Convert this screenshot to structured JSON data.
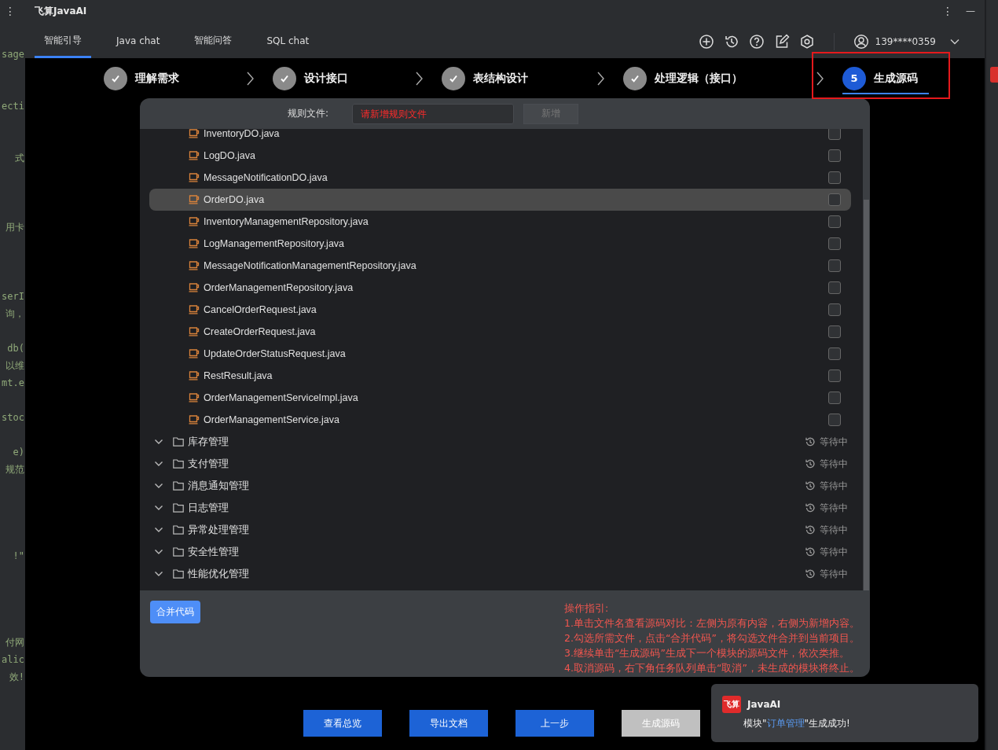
{
  "editor_fragments": [
    "sage",
    "ecti",
    "式",
    "用卡",
    "serI",
    "询，",
    "db(",
    "以维",
    "mt.e",
    "stoc",
    "e)",
    "规范",
    "!\"",
    "付网",
    "alic",
    "效!"
  ],
  "window": {
    "title": "飞算JavaAI",
    "menu_glyph": "⋮",
    "more_glyph": "⋮",
    "minimize_glyph": "—"
  },
  "tabs": [
    {
      "label": "智能引导",
      "selected": true
    },
    {
      "label": "Java chat",
      "selected": false
    },
    {
      "label": "智能问答",
      "selected": false
    },
    {
      "label": "SQL chat",
      "selected": false
    }
  ],
  "user": {
    "phone": "139****0359"
  },
  "steps": [
    {
      "label": "理解需求",
      "done": true,
      "highlighted": false
    },
    {
      "label": "设计接口",
      "done": true,
      "highlighted": false
    },
    {
      "label": "表结构设计",
      "done": true,
      "highlighted": false
    },
    {
      "label": "处理逻辑（接口）",
      "done": true,
      "highlighted": false
    },
    {
      "label": "生成源码",
      "done": false,
      "number": "5",
      "highlighted": true
    }
  ],
  "rules": {
    "label": "规则文件:",
    "placeholder": "请新增规则文件",
    "add_button": "新增"
  },
  "files": [
    {
      "name": "InventoryDO.java",
      "checked": false,
      "selected": false
    },
    {
      "name": "LogDO.java",
      "checked": false,
      "selected": false
    },
    {
      "name": "MessageNotificationDO.java",
      "checked": false,
      "selected": false
    },
    {
      "name": "OrderDO.java",
      "checked": false,
      "selected": true
    },
    {
      "name": "InventoryManagementRepository.java",
      "checked": false,
      "selected": false
    },
    {
      "name": "LogManagementRepository.java",
      "checked": false,
      "selected": false
    },
    {
      "name": "MessageNotificationManagementRepository.java",
      "checked": false,
      "selected": false
    },
    {
      "name": "OrderManagementRepository.java",
      "checked": false,
      "selected": false
    },
    {
      "name": "CancelOrderRequest.java",
      "checked": false,
      "selected": false
    },
    {
      "name": "CreateOrderRequest.java",
      "checked": false,
      "selected": false
    },
    {
      "name": "UpdateOrderStatusRequest.java",
      "checked": false,
      "selected": false
    },
    {
      "name": "RestResult.java",
      "checked": false,
      "selected": false
    },
    {
      "name": "OrderManagementServiceImpl.java",
      "checked": false,
      "selected": false
    },
    {
      "name": "OrderManagementService.java",
      "checked": false,
      "selected": false
    }
  ],
  "modules": [
    {
      "name": "库存管理",
      "status": "等待中"
    },
    {
      "name": "支付管理",
      "status": "等待中"
    },
    {
      "name": "消息通知管理",
      "status": "等待中"
    },
    {
      "name": "日志管理",
      "status": "等待中"
    },
    {
      "name": "异常处理管理",
      "status": "等待中"
    },
    {
      "name": "安全性管理",
      "status": "等待中"
    },
    {
      "name": "性能优化管理",
      "status": "等待中"
    }
  ],
  "merge_button": "合并代码",
  "guide": [
    "操作指引:",
    "1.单击文件名查看源码对比：左侧为原有内容，右侧为新增内容。",
    "2.勾选所需文件，点击“合并代码”，将勾选文件合并到当前项目。",
    "3.继续单击“生成源码”生成下一个模块的源码文件，依次类推。",
    "4.取消源码，右下角任务队列单击“取消”，未生成的模块将终止。"
  ],
  "actions": [
    {
      "label": "查看总览",
      "disabled": false
    },
    {
      "label": "导出文档",
      "disabled": false
    },
    {
      "label": "上一步",
      "disabled": false
    },
    {
      "label": "生成源码",
      "disabled": true
    }
  ],
  "toast": {
    "logo_text": "飞算",
    "title": "JavaAI",
    "message_before": "模块\"",
    "message_highlight": "订单管理",
    "message_after": "\"生成成功!"
  }
}
